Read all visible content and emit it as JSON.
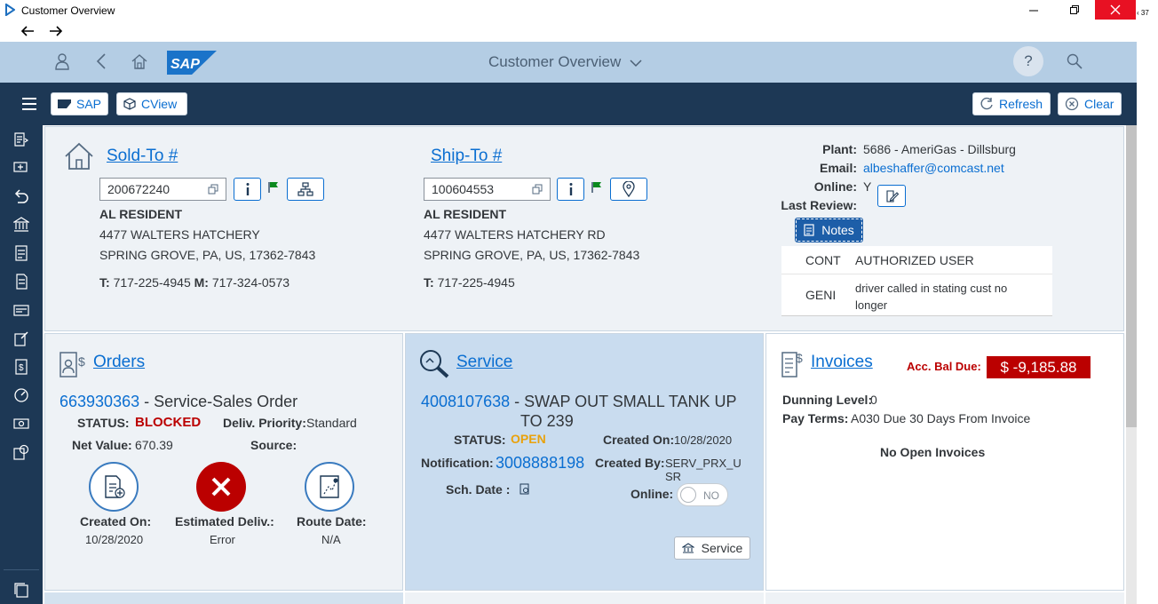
{
  "window": {
    "title": "Customer Overview",
    "badge": "37"
  },
  "shell": {
    "title": "Customer Overview",
    "help": "?"
  },
  "toolbar": {
    "sap_label": "SAP",
    "cview_label": "CView",
    "refresh_label": "Refresh",
    "clear_label": "Clear"
  },
  "soldto": {
    "title": "Sold-To #",
    "number": "200672240",
    "name": "AL RESIDENT",
    "street": "4477 WALTERS HATCHERY",
    "city": "SPRING GROVE, PA, US, 17362-7843",
    "t_label": "T:",
    "t_value": "717-225-4945",
    "m_label": "M:",
    "m_value": "717-324-0573"
  },
  "shipto": {
    "title": "Ship-To #",
    "number": "100604553",
    "name": "AL RESIDENT",
    "street": "4477 WALTERS HATCHERY RD",
    "city": "SPRING GROVE, PA, US, 17362-7843",
    "t_label": "T:",
    "t_value": "717-225-4945"
  },
  "info": {
    "plant_label": "Plant:",
    "plant_value": "5686 - AmeriGas - Dillsburg",
    "email_label": "Email:",
    "email_value": "albeshaffer@comcast.net",
    "online_label": "Online:",
    "online_value": "Y",
    "review_label": "Last Review:",
    "notes_label": "Notes",
    "notes": [
      {
        "code": "CONT",
        "text": "AUTHORIZED USER"
      },
      {
        "code": "GENI",
        "text": "driver called in stating cust no longer"
      }
    ]
  },
  "orders": {
    "title": "Orders",
    "order_number": "663930363",
    "order_type": " - Service-Sales Order",
    "status_label": "STATUS:",
    "status_value": "BLOCKED",
    "priority_label": "Deliv. Priority:",
    "priority_value": "Standard",
    "netvalue_label": "Net Value:",
    "netvalue_value": "670.39",
    "source_label": "Source:",
    "created_label": "Created On:",
    "created_value": "10/28/2020",
    "estdeliv_label": "Estimated Deliv.:",
    "estdeliv_value": "Error",
    "route_label": "Route Date:",
    "route_value": "N/A"
  },
  "service": {
    "title": "Service",
    "number": "4008107638",
    "desc1": " - SWAP OUT SMALL TANK UP",
    "desc2": "TO 239",
    "status_label": "STATUS:",
    "status_value": "OPEN",
    "createdon_label": "Created On:",
    "createdon_value": "10/28/2020",
    "notif_label": "Notification:",
    "notif_value": "3008888198",
    "createdby_label": "Created By:",
    "createdby_value1": "SERV_PRX_U",
    "createdby_value2": "SR",
    "schdate_label": "Sch. Date :",
    "online_label": "Online:",
    "online_toggle": "NO",
    "button_label": "Service"
  },
  "invoices": {
    "title": "Invoices",
    "balance_label": "Acc. Bal Due:",
    "balance_value": "$ -9,185.88",
    "dunning_label": "Dunning Level:",
    "dunning_value": "0",
    "payterms_label": "Pay Terms:",
    "payterms_value": "A030 Due 30 Days From Invoice",
    "empty_text": "No Open Invoices"
  },
  "colors": {
    "shell": "#b4cde4",
    "toolbar": "#1d3855",
    "link": "#0a6ed1",
    "blocked": "#bb0000",
    "open": "#e9a20c",
    "balance_bg": "#bb0000"
  }
}
